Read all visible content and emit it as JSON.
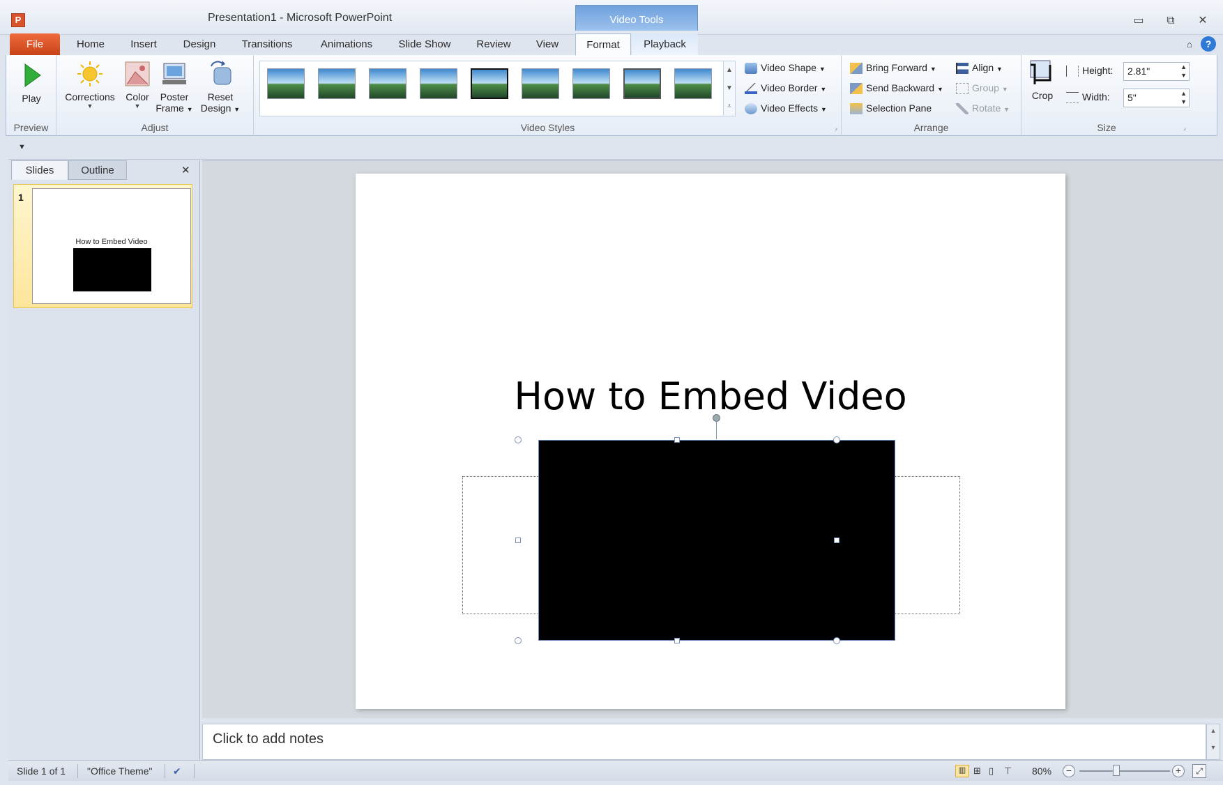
{
  "window": {
    "title": "Presentation1  -  Microsoft PowerPoint",
    "app_icon_letter": "P",
    "context_tool": "Video Tools",
    "controls": {
      "minimize": "▭",
      "restore": "⧉",
      "close": "✕"
    }
  },
  "tabs": [
    "File",
    "Home",
    "Insert",
    "Design",
    "Transitions",
    "Animations",
    "Slide Show",
    "Review",
    "View",
    "Format",
    "Playback"
  ],
  "active_tab": "Format",
  "help_icons": {
    "minimize_ribbon": "⌂",
    "help": "?"
  },
  "ribbon": {
    "preview": {
      "label": "Preview",
      "play": "Play"
    },
    "adjust": {
      "label": "Adjust",
      "corrections": "Corrections",
      "color": "Color",
      "poster_frame_line1": "Poster",
      "poster_frame_line2": "Frame",
      "reset_design_line1": "Reset",
      "reset_design_line2": "Design"
    },
    "video_styles": {
      "label": "Video Styles",
      "video_shape": "Video Shape",
      "video_border": "Video Border",
      "video_effects": "Video Effects"
    },
    "arrange": {
      "label": "Arrange",
      "bring_forward": "Bring Forward",
      "send_backward": "Send Backward",
      "selection_pane": "Selection Pane",
      "align": "Align",
      "group": "Group",
      "rotate": "Rotate"
    },
    "size": {
      "label": "Size",
      "crop": "Crop",
      "height_label": "Height:",
      "height_value": "2.81\"",
      "width_label": "Width:",
      "width_value": "5\""
    }
  },
  "left_pane": {
    "tabs": [
      "Slides",
      "Outline"
    ],
    "close": "✕",
    "slide_number": "1",
    "thumb_title": "How to Embed Video"
  },
  "slide": {
    "title": "How to Embed Video"
  },
  "notes_placeholder": "Click to add notes",
  "status": {
    "slide_info": "Slide 1 of 1",
    "theme": "\"Office Theme\"",
    "zoom": "80%",
    "zoom_level_percent": 80
  }
}
